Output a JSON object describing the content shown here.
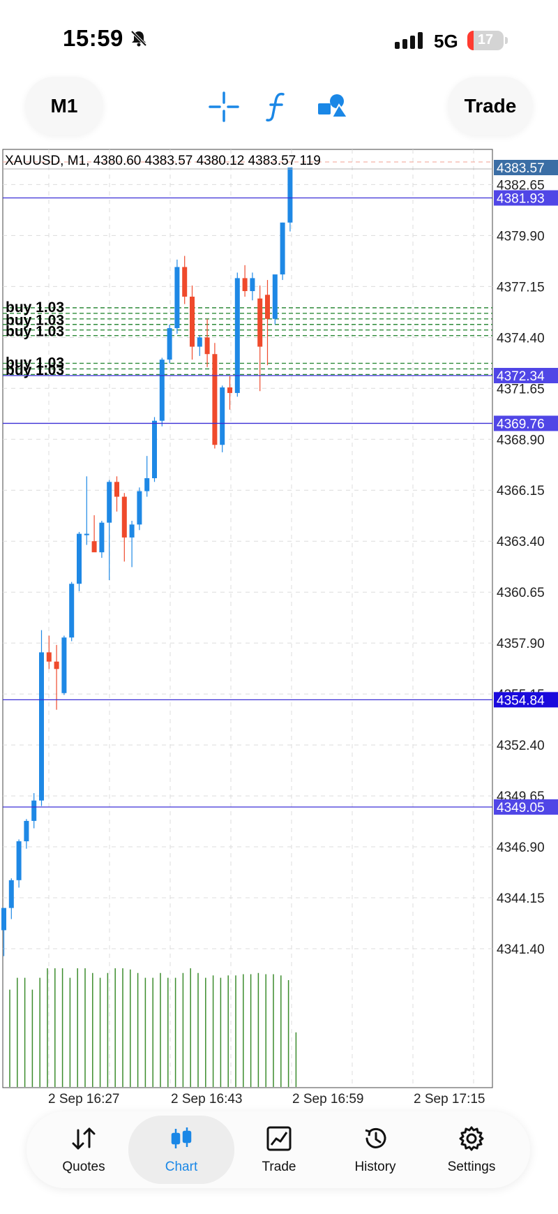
{
  "status_bar": {
    "time": "15:59",
    "network": "5G",
    "battery": "17"
  },
  "toolbar": {
    "timeframe": "M1",
    "trade": "Trade",
    "icons": [
      "crosshair-icon",
      "function-icon",
      "objects-icon"
    ]
  },
  "chart": {
    "info": "XAUUSD, M1, 4380.60 4383.57 4380.12 4383.57 119",
    "price_labels": [
      "4382.65",
      "4379.90",
      "4377.15",
      "4374.40",
      "4371.65",
      "4368.90",
      "4366.15",
      "4363.40",
      "4360.65",
      "4357.90",
      "4355.15",
      "4352.40",
      "4349.65",
      "4346.90",
      "4344.15",
      "4341.40"
    ],
    "line_labels": [
      "4383.57",
      "4381.93",
      "4372.34",
      "4369.76",
      "4354.84",
      "4349.05"
    ],
    "time_labels": [
      "2 Sep 16:27",
      "2 Sep 16:43",
      "2 Sep 16:59",
      "2 Sep 17:15"
    ],
    "order_label": "buy 1.03",
    "colors": {
      "bull": "#1e88e5",
      "bear": "#ef4a2c",
      "volume": "#3c8c2d",
      "level_line": "#3a2fd6",
      "price_label_bg": "#3b6ea5",
      "order_line": "#2e8b3a"
    }
  },
  "chart_data": {
    "type": "candlestick",
    "symbol": "XAUUSD",
    "timeframe": "M1",
    "last_bar": {
      "open": 4380.6,
      "high": 4383.57,
      "low": 4380.12,
      "close": 4383.57,
      "volume": 119
    },
    "ylim": [
      4338.65,
      4385.0
    ],
    "candles": [
      {
        "o": 4342.4,
        "h": 4343.6,
        "l": 4341.0,
        "c": 4343.6
      },
      {
        "o": 4343.6,
        "h": 4345.2,
        "l": 4343.0,
        "c": 4345.1
      },
      {
        "o": 4345.1,
        "h": 4347.3,
        "l": 4344.7,
        "c": 4347.2
      },
      {
        "o": 4347.2,
        "h": 4348.4,
        "l": 4346.8,
        "c": 4348.3
      },
      {
        "o": 4348.3,
        "h": 4349.8,
        "l": 4347.9,
        "c": 4349.4
      },
      {
        "o": 4349.4,
        "h": 4358.6,
        "l": 4349.1,
        "c": 4357.4
      },
      {
        "o": 4357.4,
        "h": 4358.3,
        "l": 4356.5,
        "c": 4356.9
      },
      {
        "o": 4356.9,
        "h": 4357.8,
        "l": 4354.3,
        "c": 4356.5
      },
      {
        "o": 4355.2,
        "h": 4358.3,
        "l": 4355.1,
        "c": 4358.2
      },
      {
        "o": 4358.2,
        "h": 4361.2,
        "l": 4358.0,
        "c": 4361.1
      },
      {
        "o": 4361.1,
        "h": 4363.9,
        "l": 4360.7,
        "c": 4363.8
      },
      {
        "o": 4363.8,
        "h": 4366.9,
        "l": 4363.2,
        "c": 4363.8
      },
      {
        "o": 4363.4,
        "h": 4364.8,
        "l": 4363.0,
        "c": 4362.8
      },
      {
        "o": 4362.8,
        "h": 4364.5,
        "l": 4362.5,
        "c": 4364.4
      },
      {
        "o": 4364.4,
        "h": 4366.7,
        "l": 4361.3,
        "c": 4366.6
      },
      {
        "o": 4366.6,
        "h": 4366.9,
        "l": 4365.0,
        "c": 4365.8
      },
      {
        "o": 4365.8,
        "h": 4366.0,
        "l": 4362.3,
        "c": 4363.6
      },
      {
        "o": 4363.6,
        "h": 4364.5,
        "l": 4362.0,
        "c": 4364.3
      },
      {
        "o": 4364.3,
        "h": 4366.3,
        "l": 4364.0,
        "c": 4366.1
      },
      {
        "o": 4366.1,
        "h": 4368.0,
        "l": 4365.8,
        "c": 4366.8
      },
      {
        "o": 4366.8,
        "h": 4370.1,
        "l": 4366.6,
        "c": 4369.9
      },
      {
        "o": 4369.9,
        "h": 4373.3,
        "l": 4369.6,
        "c": 4373.2
      },
      {
        "o": 4373.2,
        "h": 4375.1,
        "l": 4373.0,
        "c": 4374.9
      },
      {
        "o": 4374.9,
        "h": 4378.6,
        "l": 4374.6,
        "c": 4378.2
      },
      {
        "o": 4378.2,
        "h": 4378.8,
        "l": 4376.2,
        "c": 4376.6
      },
      {
        "o": 4376.6,
        "h": 4377.2,
        "l": 4373.2,
        "c": 4373.9
      },
      {
        "o": 4373.9,
        "h": 4374.5,
        "l": 4373.4,
        "c": 4374.4
      },
      {
        "o": 4374.4,
        "h": 4375.4,
        "l": 4372.8,
        "c": 4373.5
      },
      {
        "o": 4373.5,
        "h": 4374.1,
        "l": 4368.4,
        "c": 4368.6
      },
      {
        "o": 4368.6,
        "h": 4371.8,
        "l": 4368.2,
        "c": 4371.7
      },
      {
        "o": 4371.7,
        "h": 4372.3,
        "l": 4370.5,
        "c": 4371.4
      },
      {
        "o": 4371.4,
        "h": 4377.9,
        "l": 4371.2,
        "c": 4377.6
      },
      {
        "o": 4377.6,
        "h": 4378.3,
        "l": 4376.6,
        "c": 4376.9
      },
      {
        "o": 4376.9,
        "h": 4377.9,
        "l": 4376.4,
        "c": 4377.6
      },
      {
        "o": 4376.5,
        "h": 4377.2,
        "l": 4371.5,
        "c": 4373.9
      },
      {
        "o": 4376.7,
        "h": 4377.5,
        "l": 4372.9,
        "c": 4375.4
      },
      {
        "o": 4375.4,
        "h": 4377.7,
        "l": 4375.1,
        "c": 4377.8
      },
      {
        "o": 4377.8,
        "h": 4380.6,
        "l": 4377.5,
        "c": 4380.6
      },
      {
        "o": 4380.6,
        "h": 4383.57,
        "l": 4380.12,
        "c": 4383.57
      }
    ],
    "volumes": [
      82,
      92,
      92,
      82,
      92,
      100,
      100,
      100,
      92,
      100,
      100,
      96,
      92,
      96,
      100,
      100,
      99,
      96,
      92,
      92,
      96,
      92,
      92,
      96,
      100,
      96,
      92,
      94,
      92,
      94,
      94,
      95,
      95,
      96,
      95,
      95,
      94,
      90,
      46
    ],
    "level_lines": [
      4381.93,
      4372.34,
      4369.76,
      4354.84,
      4349.05
    ],
    "order_lines": [
      4376.0,
      4375.7,
      4375.4,
      4375.1,
      4374.8,
      4374.5,
      4373.0,
      4372.7,
      4372.4
    ],
    "x_ticks": [
      "2 Sep 16:27",
      "2 Sep 16:43",
      "2 Sep 16:59",
      "2 Sep 17:15"
    ]
  },
  "nav": {
    "items": [
      {
        "label": "Quotes",
        "icon": "arrows-updown-icon"
      },
      {
        "label": "Chart",
        "icon": "candles-icon"
      },
      {
        "label": "Trade",
        "icon": "line-chart-icon"
      },
      {
        "label": "History",
        "icon": "history-icon"
      },
      {
        "label": "Settings",
        "icon": "gear-icon"
      }
    ]
  }
}
